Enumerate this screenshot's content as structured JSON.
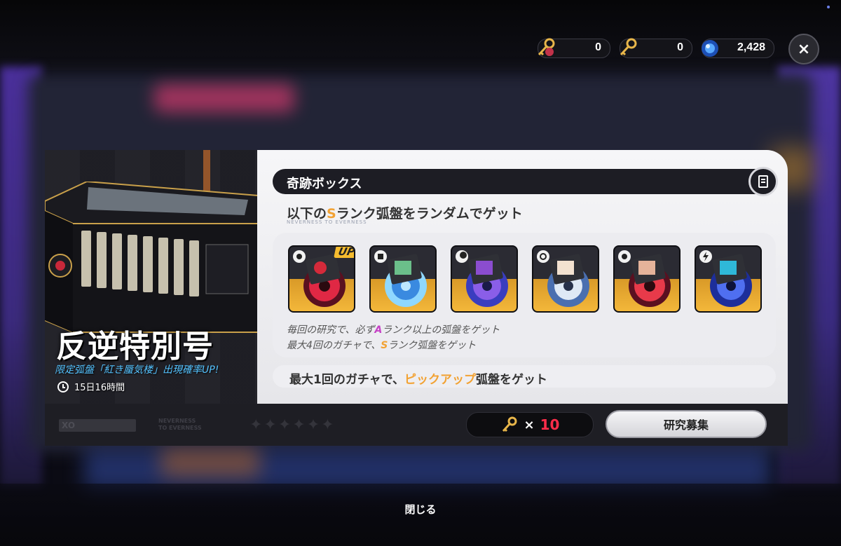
{
  "currency": [
    {
      "icon": "key-red-icon",
      "amount": "0"
    },
    {
      "icon": "key-gold-icon",
      "amount": "0"
    },
    {
      "icon": "orb-blue-icon",
      "amount": "2,428"
    }
  ],
  "close_icon": "×",
  "banner": {
    "title": "反逆特別号",
    "rate_up": "限定弧盤「紅き蜃気楼」出現確率UP!",
    "timer": "15日16時間"
  },
  "box": {
    "header": "奇跡ボックス",
    "subtitle_pre": "以下の",
    "subtitle_rank": "S",
    "subtitle_post": "ランク弧盤をランダムでゲット",
    "subtitle_small": "NEVERNESS TO EVERNESS",
    "disks": [
      {
        "badge": "gear-icon",
        "art": "red",
        "up": "UP"
      },
      {
        "badge": "cube-icon",
        "art": "cyan",
        "up": ""
      },
      {
        "badge": "moon-icon",
        "art": "purple",
        "up": ""
      },
      {
        "badge": "swirl-icon",
        "art": "white",
        "up": ""
      },
      {
        "badge": "gear-icon",
        "art": "red",
        "up": ""
      },
      {
        "badge": "bolt-icon",
        "art": "blue",
        "up": ""
      }
    ],
    "note1_pre": "毎回の研究で、必ず",
    "note1_rank": "A",
    "note1_post": "ランク以上の弧盤をゲット",
    "note2_pre": "最大4回のガチャで、",
    "note2_rank": "S",
    "note2_post": "ランク弧盤をゲット",
    "pickup_pre": "最大1回のガチャで、",
    "pickup_hl": "ピックアップ",
    "pickup_post": "弧盤をゲット"
  },
  "footer": {
    "xo": "XO",
    "brand_line1": "NEVERNESS",
    "brand_line2": "TO EVERNESS",
    "stars": "✦✦✦✦✦✦",
    "cost_multiplier": "×",
    "cost_amount": "10",
    "research_label": "研究募集"
  },
  "close_label": "閉じる"
}
